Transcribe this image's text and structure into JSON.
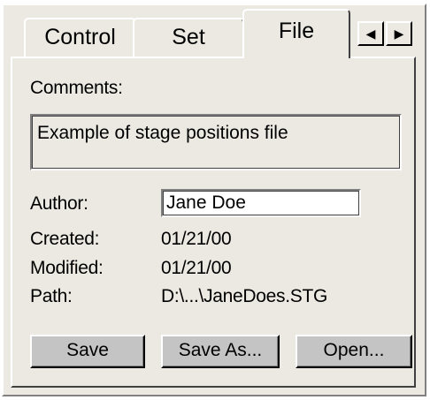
{
  "tabs": [
    {
      "label": "Control",
      "active": false
    },
    {
      "label": "Set",
      "active": false
    },
    {
      "label": "File",
      "active": true
    }
  ],
  "tab_scroll": {
    "left_icon": "arrow-left-icon",
    "right_icon": "arrow-right-icon",
    "left_glyph": "◀",
    "right_glyph": "▶"
  },
  "file_panel": {
    "comments_label": "Comments:",
    "comments_value": "Example of stage positions file",
    "author_label": "Author:",
    "author_value": "Jane Doe",
    "created_label": "Created:",
    "created_value": "01/21/00",
    "modified_label": "Modified:",
    "modified_value": "01/21/00",
    "path_label": "Path:",
    "path_value": "D:\\...\\JaneDoes.STG"
  },
  "buttons": {
    "save": "Save",
    "save_as": "Save As...",
    "open": "Open..."
  },
  "colors": {
    "panel_bg": "#ece9e2",
    "button_bg": "#c4c4c4",
    "input_bg": "#ffffff"
  }
}
